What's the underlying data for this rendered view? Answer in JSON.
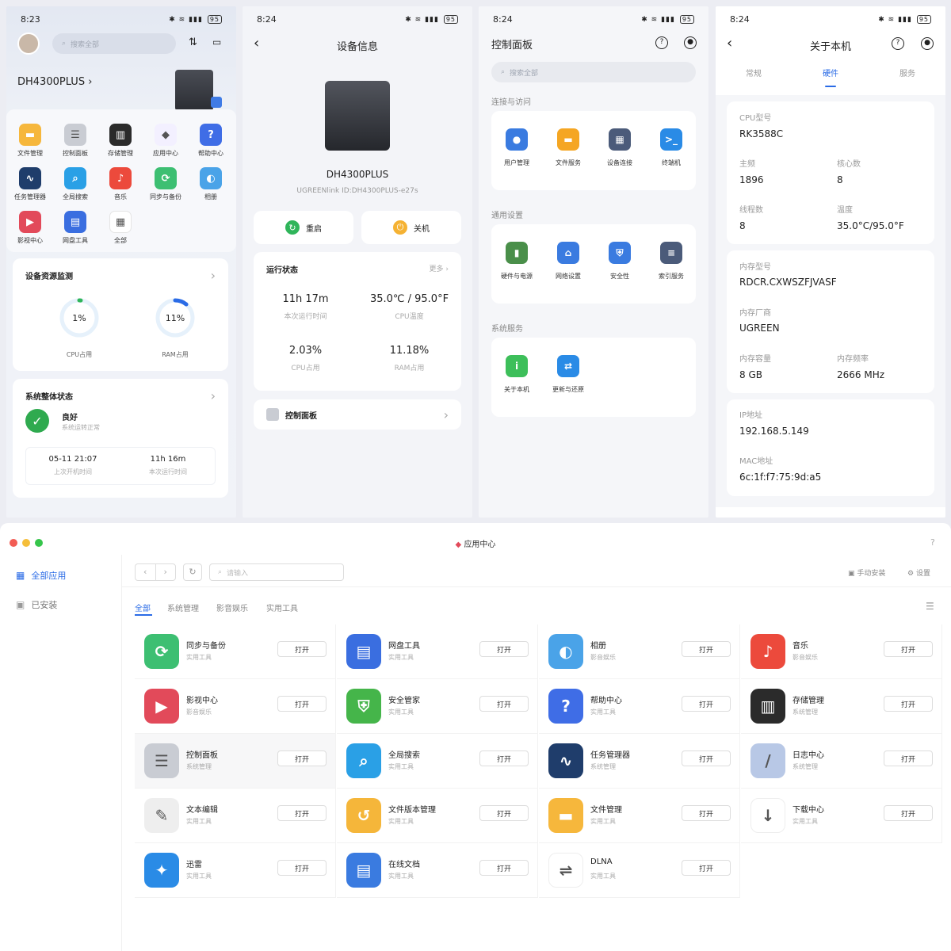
{
  "phone1": {
    "time": "8:23",
    "battery": "95",
    "search_placeholder": "搜索全部",
    "device_name": "DH4300PLUS",
    "apps": [
      {
        "label": "文件管理",
        "icon": "folder-icon",
        "color": "#f6b73c"
      },
      {
        "label": "控制面板",
        "icon": "control-panel-icon",
        "color": "#c9ccd3"
      },
      {
        "label": "存储管理",
        "icon": "storage-icon",
        "color": "#2b2b2b"
      },
      {
        "label": "应用中心",
        "icon": "app-center-icon",
        "color": "#f3f0ff"
      },
      {
        "label": "帮助中心",
        "icon": "help-icon",
        "color": "#3f6de6"
      },
      {
        "label": "任务管理器",
        "icon": "task-manager-icon",
        "color": "#1f3d6b"
      },
      {
        "label": "全局搜索",
        "icon": "search-icon",
        "color": "#2aa0e6"
      },
      {
        "label": "音乐",
        "icon": "music-icon",
        "color": "#ec4a3c"
      },
      {
        "label": "同步与备份",
        "icon": "sync-icon",
        "color": "#3dbf72"
      },
      {
        "label": "相册",
        "icon": "photo-icon",
        "color": "#4aa3e8"
      },
      {
        "label": "影视中心",
        "icon": "video-icon",
        "color": "#e24a5a"
      },
      {
        "label": "网盘工具",
        "icon": "cloud-drive-icon",
        "color": "#3a6ee0"
      },
      {
        "label": "全部",
        "icon": "all-apps-icon",
        "color": "#ffffff"
      }
    ],
    "monitor_title": "设备资源监测",
    "cpu_value": "1%",
    "cpu_label": "CPU占用",
    "ram_value": "11%",
    "ram_label": "RAM占用",
    "cpu_fraction": 0.01,
    "ram_fraction": 0.11,
    "status_title": "系统整体状态",
    "status_value": "良好",
    "status_desc": "系统运转正常",
    "last_boot": "05-11 21:07",
    "last_boot_label": "上次开机时间",
    "uptime": "11h 16m",
    "uptime_label": "本次运行时间"
  },
  "phone2": {
    "time": "8:24",
    "battery": "95",
    "title": "设备信息",
    "device_name": "DH4300PLUS",
    "link_id": "UGREENlink ID:DH4300PLUS-e27s",
    "restart_label": "重启",
    "shutdown_label": "关机",
    "running_title": "运行状态",
    "more_label": "更多",
    "uptime": "11h 17m",
    "uptime_label": "本次运行时间",
    "temp": "35.0℃ / 95.0°F",
    "temp_label": "CPU温度",
    "cpu": "2.03%",
    "cpu_label": "CPU占用",
    "ram": "11.18%",
    "ram_label": "RAM占用",
    "panel_label": "控制面板"
  },
  "phone3": {
    "time": "8:24",
    "battery": "95",
    "title": "控制面板",
    "search_placeholder": "搜索全部",
    "sections": [
      {
        "title": "连接与访问",
        "items": [
          {
            "label": "用户管理",
            "icon": "users-icon",
            "color": "#3a7be0"
          },
          {
            "label": "文件服务",
            "icon": "folder-icon",
            "color": "#f5a623"
          },
          {
            "label": "设备连接",
            "icon": "device-connect-icon",
            "color": "#4b5b7a"
          },
          {
            "label": "终端机",
            "icon": "terminal-icon",
            "color": "#2a8be6"
          }
        ]
      },
      {
        "title": "通用设置",
        "items": [
          {
            "label": "硬件与电源",
            "icon": "battery-icon",
            "color": "#4a8f4a"
          },
          {
            "label": "网络设置",
            "icon": "network-icon",
            "color": "#3a7be0"
          },
          {
            "label": "安全性",
            "icon": "shield-icon",
            "color": "#3a7be0"
          },
          {
            "label": "索引服务",
            "icon": "index-icon",
            "color": "#4b5b7a"
          }
        ]
      },
      {
        "title": "系统服务",
        "items": [
          {
            "label": "关于本机",
            "icon": "info-icon",
            "color": "#3dbf5a"
          },
          {
            "label": "更新与还原",
            "icon": "update-icon",
            "color": "#2a8be6"
          }
        ]
      }
    ]
  },
  "phone4": {
    "time": "8:24",
    "battery": "95",
    "title": "关于本机",
    "tabs": [
      "常规",
      "硬件",
      "服务"
    ],
    "active_tab": "硬件",
    "cpu_model_label": "CPU型号",
    "cpu_model": "RK3588C",
    "freq_label": "主频",
    "freq": "1896",
    "cores_label": "核心数",
    "cores": "8",
    "threads_label": "线程数",
    "threads": "8",
    "temp_label": "温度",
    "temp": "35.0°C/95.0°F",
    "mem_model_label": "内存型号",
    "mem_model": "RDCR.CXWSZFJVASF",
    "mem_vendor_label": "内存厂商",
    "mem_vendor": "UGREEN",
    "mem_size_label": "内存容量",
    "mem_size": "8 GB",
    "mem_freq_label": "内存频率",
    "mem_freq": "2666 MHz",
    "ip_label": "IP地址",
    "ip": "192.168.5.149",
    "mac_label": "MAC地址",
    "mac": "6c:1f:f7:75:9d:a5"
  },
  "desktop": {
    "window_title": "应用中心",
    "help": "?",
    "sidebar": [
      {
        "label": "全部应用",
        "icon": "grid-icon",
        "active": true
      },
      {
        "label": "已安装",
        "icon": "installed-icon",
        "active": false
      }
    ],
    "search_placeholder": "请输入",
    "manual_install": "手动安装",
    "settings": "设置",
    "filter_tabs": [
      "全部",
      "系统管理",
      "影音娱乐",
      "实用工具"
    ],
    "open_label": "打开",
    "apps": [
      {
        "name": "同步与备份",
        "cat": "实用工具",
        "icon": "sync-icon",
        "color": "#3dbf72"
      },
      {
        "name": "网盘工具",
        "cat": "实用工具",
        "icon": "cloud-drive-icon",
        "color": "#3a6ee0"
      },
      {
        "name": "相册",
        "cat": "影音娱乐",
        "icon": "photo-icon",
        "color": "#4aa3e8"
      },
      {
        "name": "音乐",
        "cat": "影音娱乐",
        "icon": "music-icon",
        "color": "#ec4a3c"
      },
      {
        "name": "影视中心",
        "cat": "影音娱乐",
        "icon": "video-icon",
        "color": "#e24a5a"
      },
      {
        "name": "安全管家",
        "cat": "实用工具",
        "icon": "shield-icon",
        "color": "#45b54a"
      },
      {
        "name": "帮助中心",
        "cat": "实用工具",
        "icon": "help-icon",
        "color": "#3f6de6"
      },
      {
        "name": "存储管理",
        "cat": "系统管理",
        "icon": "storage-icon",
        "color": "#2b2b2b"
      },
      {
        "name": "控制面板",
        "cat": "系统管理",
        "icon": "control-panel-icon",
        "color": "#c9ccd3"
      },
      {
        "name": "全局搜索",
        "cat": "实用工具",
        "icon": "search-icon",
        "color": "#2aa0e6"
      },
      {
        "name": "任务管理器",
        "cat": "系统管理",
        "icon": "task-manager-icon",
        "color": "#1f3d6b"
      },
      {
        "name": "日志中心",
        "cat": "系统管理",
        "icon": "logs-icon",
        "color": "#b8c8e6"
      },
      {
        "name": "文本编辑",
        "cat": "实用工具",
        "icon": "text-edit-icon",
        "color": "#eeeeee"
      },
      {
        "name": "文件版本管理",
        "cat": "实用工具",
        "icon": "file-version-icon",
        "color": "#f5b63a"
      },
      {
        "name": "文件管理",
        "cat": "实用工具",
        "icon": "folder-icon",
        "color": "#f6b73c"
      },
      {
        "name": "下载中心",
        "cat": "实用工具",
        "icon": "download-icon",
        "color": "#ffffff"
      },
      {
        "name": "迅雷",
        "cat": "实用工具",
        "icon": "thunder-icon",
        "color": "#2a8be6"
      },
      {
        "name": "在线文档",
        "cat": "实用工具",
        "icon": "document-icon",
        "color": "#3a7be0"
      },
      {
        "name": "DLNA",
        "cat": "实用工具",
        "icon": "dlna-icon",
        "color": "#ffffff"
      }
    ]
  }
}
